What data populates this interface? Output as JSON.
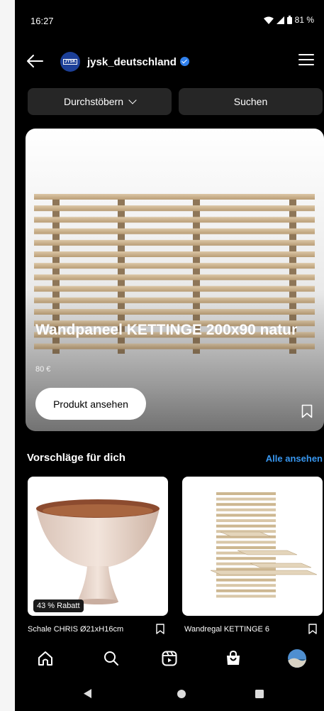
{
  "status": {
    "time": "16:27",
    "battery": "81 %"
  },
  "header": {
    "account": "jysk_deutschland",
    "logo_text": "JYSK"
  },
  "tabs": {
    "browse": "Durchstöbern",
    "search": "Suchen"
  },
  "hero": {
    "title": "Wandpaneel KETTINGE 200x90 natur",
    "price": "80 €",
    "button": "Produkt ansehen"
  },
  "suggestions": {
    "title": "Vorschläge für dich",
    "see_all": "Alle ansehen",
    "items": [
      {
        "name": "Schale CHRIS Ø21xH16cm",
        "badge": "43 % Rabatt"
      },
      {
        "name": "Wandregal KETTINGE 6"
      }
    ]
  },
  "bottom_nav": [
    "home-icon",
    "search-icon",
    "reels-icon",
    "shop-icon",
    "profile-avatar"
  ],
  "colors": {
    "background": "#000000",
    "link": "#3897f0",
    "pill": "#262626",
    "verified": "#2f80ed",
    "logo": "#1c3f97"
  }
}
